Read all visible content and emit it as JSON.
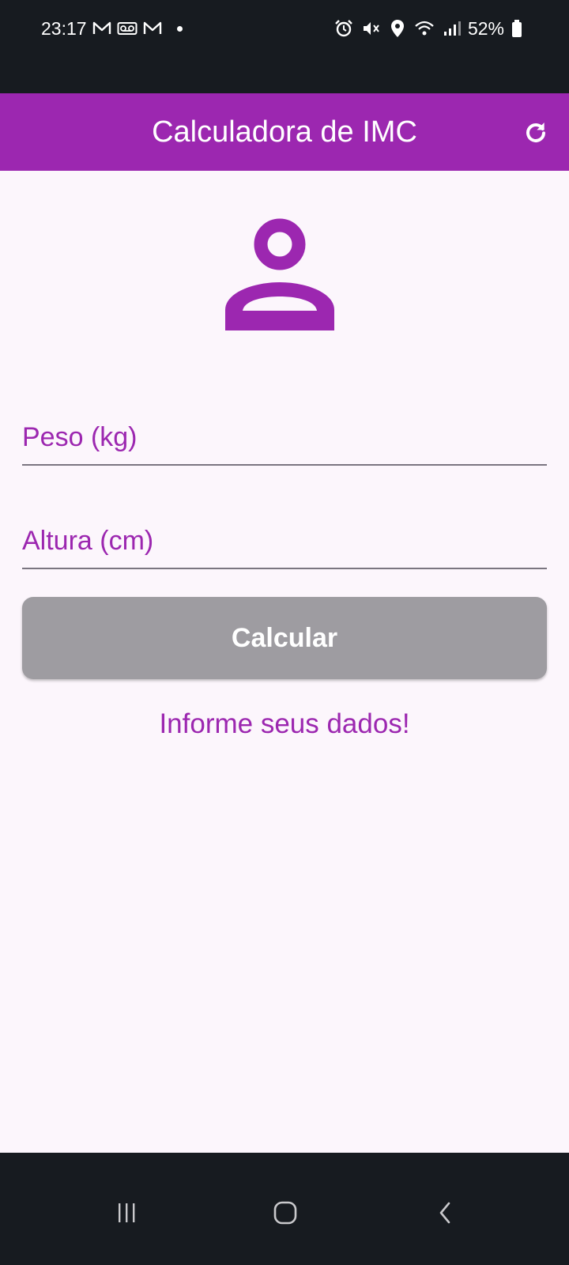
{
  "status_bar": {
    "time": "23:17",
    "battery": "52%",
    "left_icons": [
      "gmail-icon",
      "voicemail-icon",
      "gmail-icon"
    ],
    "right_icons": [
      "alarm-icon",
      "vibrate-mute-icon",
      "location-icon",
      "wifi-icon",
      "signal-icon",
      "battery-icon"
    ]
  },
  "app_bar": {
    "title": "Calculadora de IMC",
    "action_icon": "refresh-icon"
  },
  "colors": {
    "primary": "#9c27b0",
    "button_disabled": "#9e9ca1",
    "background": "#fcf6fc",
    "system_bars": "#171b20"
  },
  "form": {
    "header_icon": "person-icon",
    "weight_placeholder": "Peso (kg)",
    "weight_value": "",
    "height_placeholder": "Altura (cm)",
    "height_value": "",
    "calculate_label": "Calcular",
    "info": "Informe seus dados!"
  },
  "nav_bar": {
    "items": [
      "recents-icon",
      "home-icon",
      "back-icon"
    ]
  }
}
